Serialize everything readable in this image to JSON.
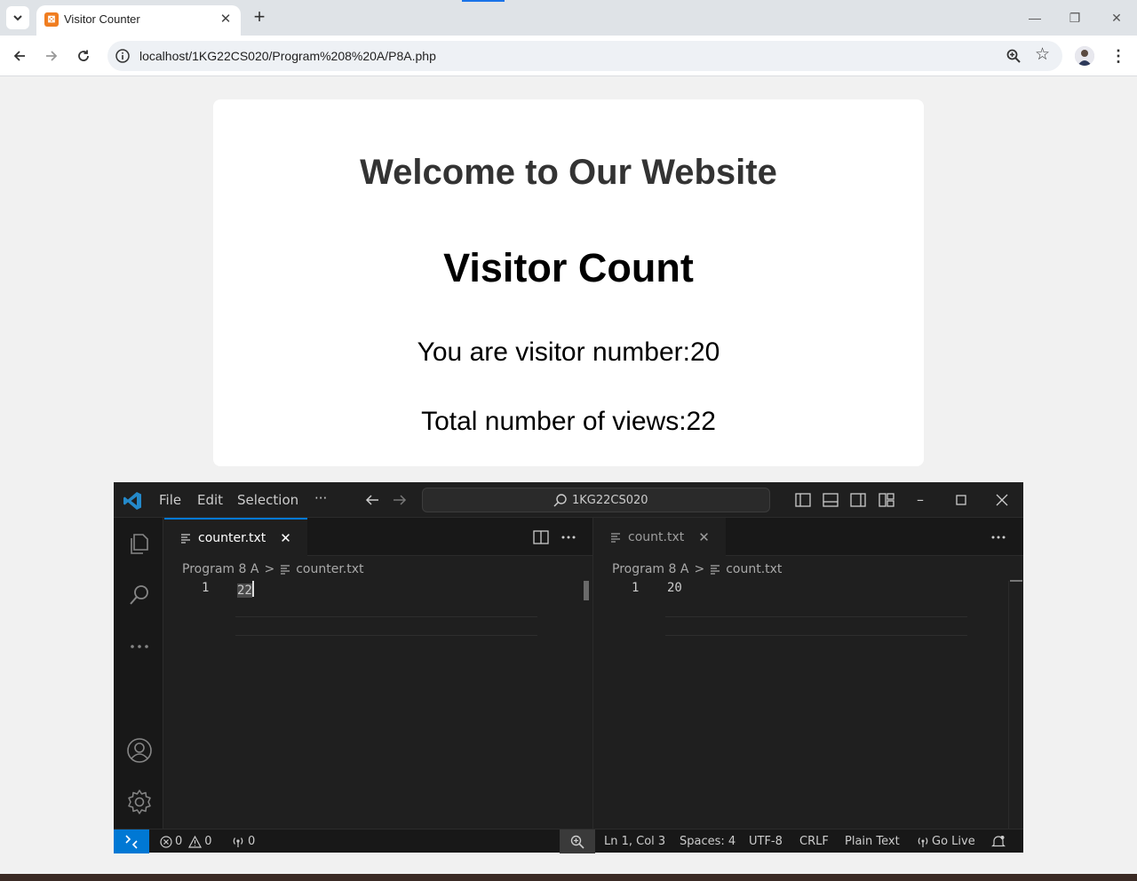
{
  "browser": {
    "tab_title": "Visitor Counter",
    "url": "localhost/1KG22CS020/Program%208%20A/P8A.php"
  },
  "page": {
    "heading": "Welcome to Our Website",
    "subheading": "Visitor Count",
    "visitor_number_text": "You are visitor number:20",
    "total_views_text": "Total number of views:22"
  },
  "vscode": {
    "menu": {
      "file": "File",
      "edit": "Edit",
      "selection": "Selection",
      "more": "···"
    },
    "search_text": "1KG22CS020",
    "left_editor": {
      "tab_label": "counter.txt",
      "breadcrumb_folder": "Program 8 A",
      "breadcrumb_file": "counter.txt",
      "line_number": "1",
      "content": "22"
    },
    "right_editor": {
      "tab_label": "count.txt",
      "breadcrumb_folder": "Program 8 A",
      "breadcrumb_file": "count.txt",
      "line_number": "1",
      "content": "20"
    },
    "status": {
      "errors": "0",
      "warnings": "0",
      "ports": "0",
      "position": "Ln 1, Col 3",
      "spaces": "Spaces: 4",
      "encoding": "UTF-8",
      "eol": "CRLF",
      "language": "Plain Text",
      "go_live": "Go Live"
    }
  },
  "colors": {
    "vscode_accent": "#0078d4",
    "chrome_accent": "#1a73e8"
  }
}
